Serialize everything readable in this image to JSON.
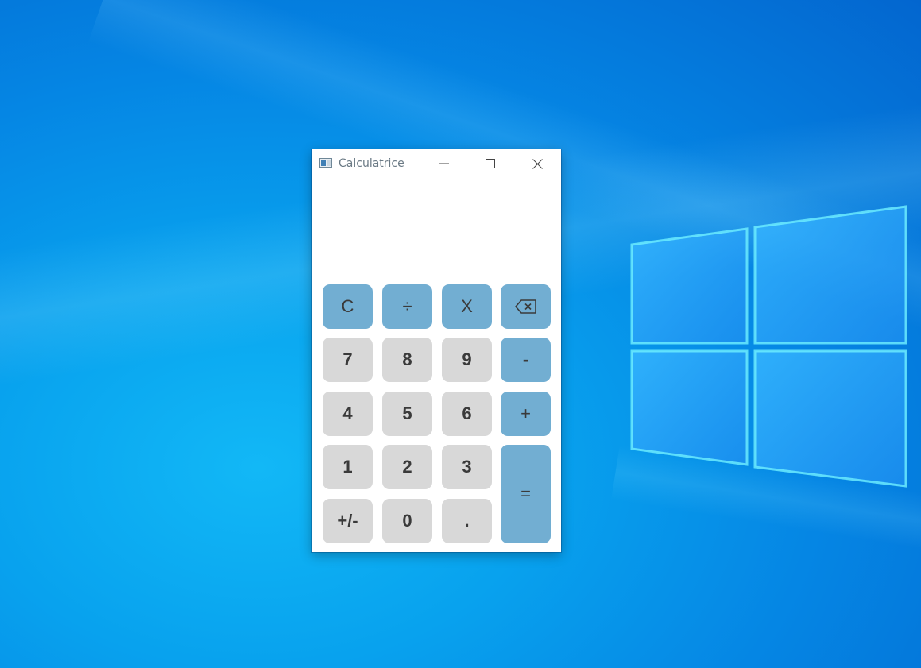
{
  "window": {
    "title": "Calculatrice"
  },
  "display": {
    "value": ""
  },
  "keys": {
    "clear": "C",
    "divide": "÷",
    "multiply": "X",
    "backspace_icon": "backspace-icon",
    "seven": "7",
    "eight": "8",
    "nine": "9",
    "minus": "-",
    "four": "4",
    "five": "5",
    "six": "6",
    "plus": "+",
    "one": "1",
    "two": "2",
    "three": "3",
    "equals": "=",
    "negate": "+/-",
    "zero": "0",
    "decimal": "."
  },
  "colors": {
    "operator_key": "#72aed2",
    "number_key": "#d8d8d8",
    "key_text": "#3a3a3a",
    "desktop": "#0586e4"
  }
}
